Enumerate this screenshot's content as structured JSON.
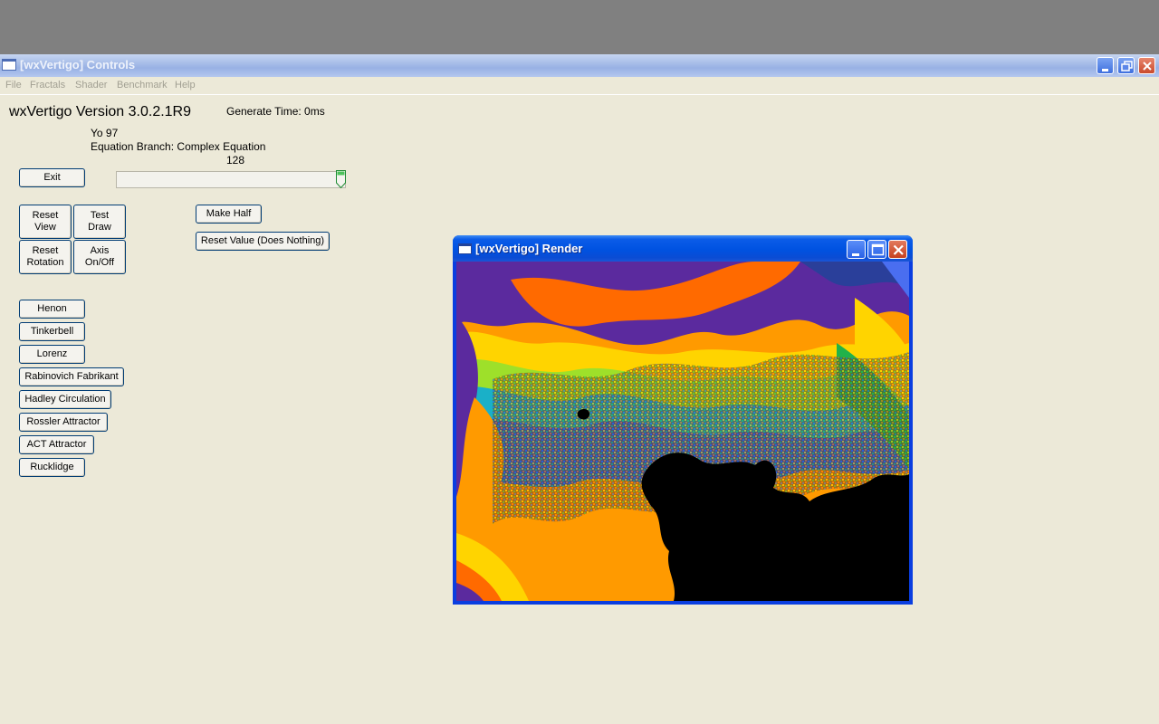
{
  "controls_window": {
    "title": "[wxVertigo] Controls",
    "menu": [
      "File",
      "Fractals",
      "Shader",
      "Benchmark",
      "Help"
    ],
    "version": "wxVertigo Version 3.0.2.1R9",
    "generate_time": "Generate Time: 0ms",
    "yo": "Yo 97",
    "equation_branch": "Equation Branch: Complex Equation",
    "slider_value": "128",
    "slider_level_fraction": 1.0,
    "buttons": {
      "exit": "Exit",
      "reset_view": "Reset\nView",
      "test_draw": "Test\nDraw",
      "reset_rotation": "Reset\nRotation",
      "axis_onoff": "Axis\nOn/Off",
      "make_half": "Make Half",
      "reset_value": "Reset Value (Does Nothing)"
    },
    "attractors": [
      "Henon",
      "Tinkerbell",
      "Lorenz",
      "Rabinovich Fabrikant",
      "Hadley Circulation",
      "Rossler Attractor",
      "ACT Attractor",
      "Rucklidge"
    ]
  },
  "render_window": {
    "title": "[wxVertigo] Render",
    "palette": [
      "#5b2a9e",
      "#7a2aa0",
      "#c0301e",
      "#ff6a00",
      "#ff9a00",
      "#ffd400",
      "#fff200",
      "#9ee02a",
      "#21b24a",
      "#1ab0c8",
      "#2a5fd6",
      "#3a2f9a"
    ]
  },
  "colors": {
    "desktop": "#808080",
    "window_face": "#ece9d8",
    "active_title": "#0052e1",
    "inactive_title": "#a7bde8"
  },
  "icons": {
    "minimize": "minimize-icon",
    "restore": "restore-icon",
    "maximize": "maximize-icon",
    "close": "close-icon",
    "app": "window-app-icon"
  }
}
